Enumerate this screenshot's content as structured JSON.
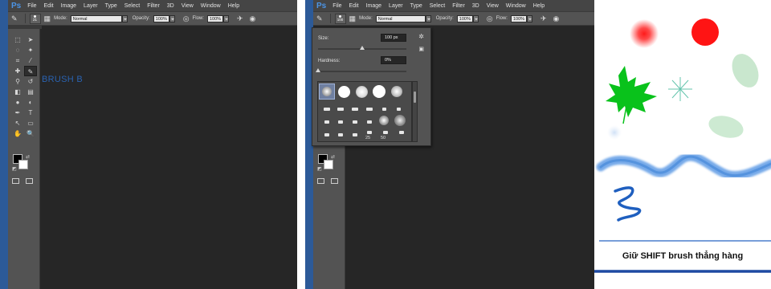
{
  "app": {
    "logo": "Ps"
  },
  "menu": [
    "File",
    "Edit",
    "Image",
    "Layer",
    "Type",
    "Select",
    "Filter",
    "3D",
    "View",
    "Window",
    "Help"
  ],
  "options_bar": {
    "brush_size_left": "21",
    "brush_size_right": "100",
    "mode_label": "Mode:",
    "mode_value": "Normal",
    "opacity_label": "Opacity:",
    "opacity_value": "100%",
    "flow_label": "Flow:",
    "flow_value": "100%"
  },
  "left_panel": {
    "brush_label": "BRUSH B"
  },
  "brush_picker": {
    "size_label": "Size:",
    "size_value": "100 px",
    "size_level": 0.5,
    "hardness_label": "Hardness:",
    "hardness_value": "0%",
    "hardness_level": 0.0,
    "tip_numbers": [
      "25",
      "50"
    ]
  },
  "canvas": {
    "caption": "Giữ SHIFT brush thẳng hàng",
    "colors": {
      "red": "#ff1a1a",
      "green": "#09c21b",
      "blue": "#2b6ed6",
      "navy": "#1e4aa2",
      "leaf": "#bfe3c6"
    }
  },
  "colors": {
    "accent": "#2a62b0",
    "chrome": "#535353",
    "workspace": "#262626"
  }
}
